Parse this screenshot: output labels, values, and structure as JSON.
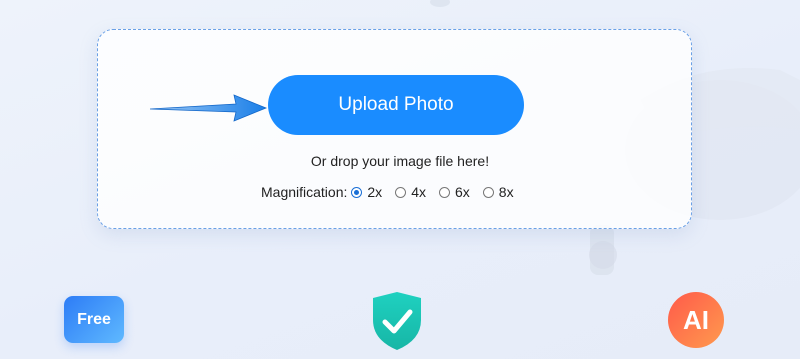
{
  "upload": {
    "button_label": "Upload Photo",
    "drop_hint": "Or drop your image file here!"
  },
  "magnification": {
    "label": "Magnification:",
    "selected": "2x",
    "options": [
      "2x",
      "4x",
      "6x",
      "8x"
    ]
  },
  "features": {
    "free_label": "Free",
    "security_icon": "shield-check-icon",
    "ai_label": "AI"
  },
  "colors": {
    "accent": "#1a8cff",
    "free_badge": "#2d7cf6",
    "shield": "#24c7b5",
    "ai_badge": "#ff6a4a"
  }
}
